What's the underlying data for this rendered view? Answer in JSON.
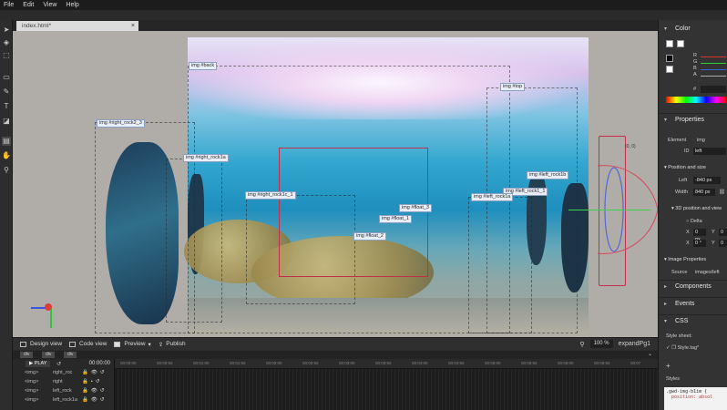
{
  "menu": [
    "File",
    "Edit",
    "View",
    "Help"
  ],
  "document_tab": {
    "name": "index.html*",
    "close": "×"
  },
  "stage_labels": {
    "back": "img #back",
    "top": "img #top",
    "right_rock2": "img #right_rock2_3",
    "right_rock1a": "img #right_rock1a",
    "right_rock1c": "img #right_rock1c_1",
    "float3": "img #float_3",
    "float1": "img #float_1",
    "float2": "img #float_2",
    "left_rock1b": "img #left_rock1b",
    "left_rock1": "img #left_rock1_1",
    "left_rock1a": "img #left_rock1a",
    "coord": "(0, 0)"
  },
  "bottom_bar": {
    "design_view": "Design view",
    "code_view": "Code view",
    "preview": "Preview",
    "publish": "Publish",
    "zoom": "100 %",
    "expand": "expandPg1"
  },
  "breadcrumbs": [
    "div",
    "div",
    "div"
  ],
  "timeline": {
    "play": "PLAY",
    "timecode": "00:00:00",
    "ticks": [
      "00:00:00",
      "00:00:50",
      "00:01:00",
      "00:01:50",
      "00:02:00",
      "00:02:50",
      "00:03:00",
      "00:03:50",
      "00:04:00",
      "00:04:50",
      "00:05:00",
      "00:05:50",
      "00:06:00",
      "00:06:50",
      "00:07"
    ],
    "layers": [
      {
        "tag": "<img>",
        "name": "right_roc"
      },
      {
        "tag": "<img>",
        "name": "right"
      },
      {
        "tag": "<img>",
        "name": "left_rock"
      },
      {
        "tag": "<img>",
        "name": "left_rock1a"
      }
    ]
  },
  "panel": {
    "color_title": "Color",
    "rgb": [
      "R",
      "G",
      "B",
      "A"
    ],
    "hash": "#",
    "properties_title": "Properties",
    "element_label": "Element",
    "element_value": "img",
    "id_label": "ID",
    "id_value": "left",
    "position_title": "Position and size",
    "left_label": "Left",
    "left_value": "-840 px",
    "width_label": "Width",
    "width_value": "840 px",
    "p3d_title": "3D position and view",
    "delta_label": "Delta",
    "x_label": "X",
    "x_value": "0 px",
    "y_label": "Y",
    "y_value": "0",
    "x2_label": "X",
    "x2_value": "0 °",
    "y2_label": "Y",
    "y2_value": "0",
    "image_props_title": "Image Properties",
    "source_label": "Source",
    "source_value": "images/left",
    "components_title": "Components",
    "events_title": "Events",
    "css_title": "CSS",
    "stylesheet_label": "Style sheet:",
    "stylesheet_value": "Style.tag*",
    "styles_label": "Styles",
    "code_line1": ".gwd-img-b1im {",
    "code_line2": "position: absol"
  }
}
